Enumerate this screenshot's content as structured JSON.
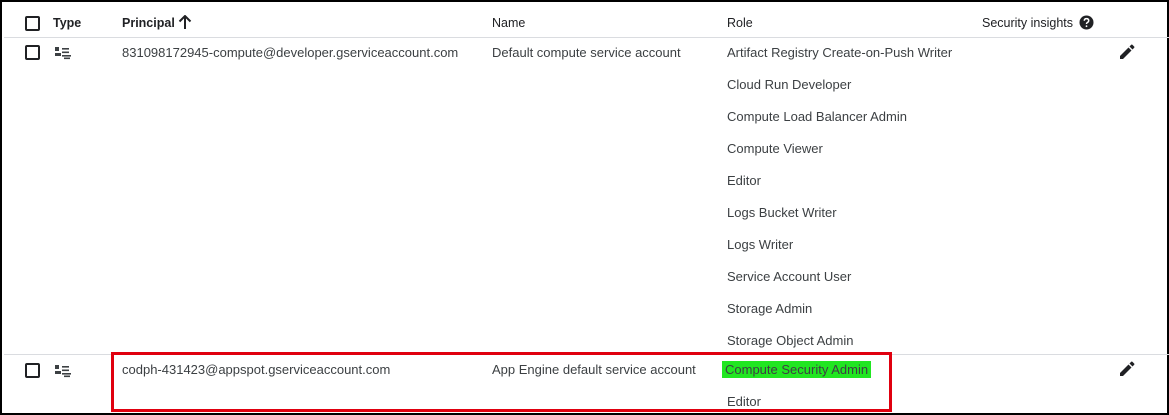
{
  "header": {
    "type_label": "Type",
    "principal_label": "Principal",
    "name_label": "Name",
    "role_label": "Role",
    "security_insights_label": "Security insights"
  },
  "rows": [
    {
      "principal": "831098172945-compute@developer.gserviceaccount.com",
      "name": "Default compute service account",
      "roles": [
        "Artifact Registry Create-on-Push Writer",
        "Cloud Run Developer",
        "Compute Load Balancer Admin",
        "Compute Viewer",
        "Editor",
        "Logs Bucket Writer",
        "Logs Writer",
        "Service Account User",
        "Storage Admin",
        "Storage Object Admin"
      ]
    },
    {
      "principal": "codph-431423@appspot.gserviceaccount.com",
      "name": "App Engine default service account",
      "roles": [
        "Compute Security Admin",
        "Editor"
      ]
    }
  ],
  "colors": {
    "highlight": "#21e621",
    "annotation_box": "#e0000f"
  },
  "icons": {
    "sort": "arrow-up-icon",
    "help": "help-circle-icon",
    "type": "service-account-icon",
    "edit": "pencil-icon"
  }
}
